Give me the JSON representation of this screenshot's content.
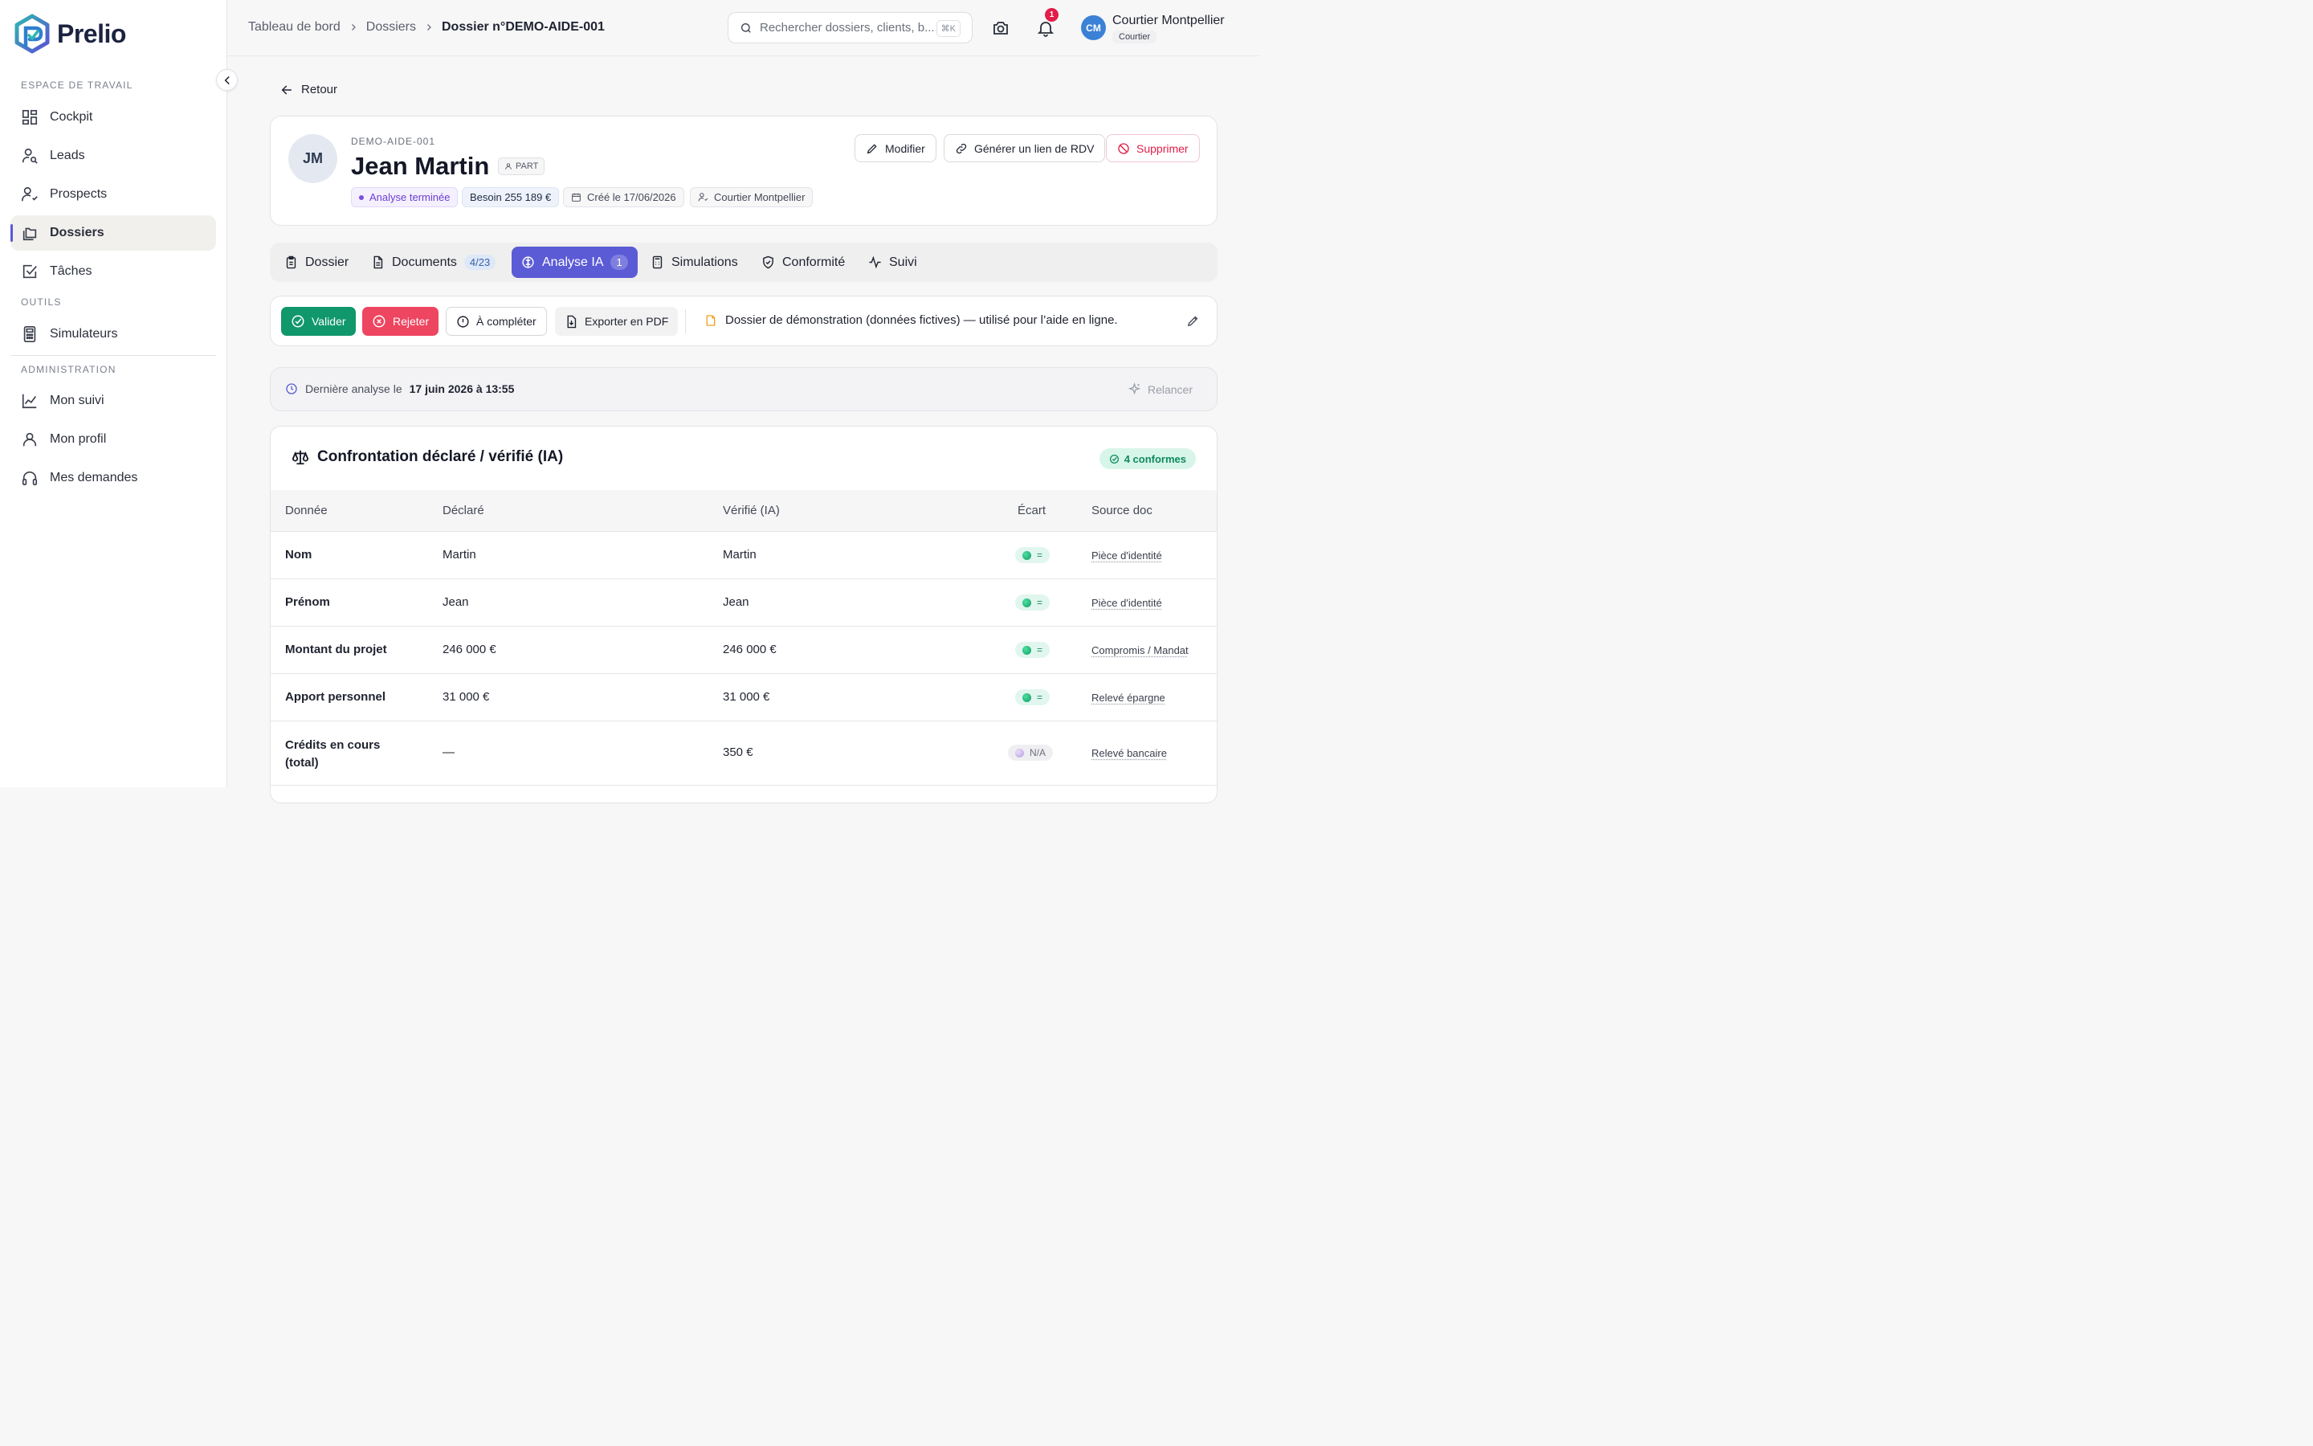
{
  "brand": {
    "name": "Prelio",
    "accent": "#5b5bd6"
  },
  "sidebar": {
    "workspace_label": "ESPACE DE TRAVAIL",
    "tools_label": "OUTILS",
    "admin_label": "ADMINISTRATION",
    "items": [
      {
        "label": "Cockpit",
        "icon": "grid-icon"
      },
      {
        "label": "Leads",
        "icon": "user-search-icon"
      },
      {
        "label": "Prospects",
        "icon": "user-check-icon"
      },
      {
        "label": "Dossiers",
        "icon": "folders-icon",
        "active": true
      },
      {
        "label": "Tâches",
        "icon": "checkbox-icon"
      },
      {
        "label": "Simulateurs",
        "icon": "calculator-icon"
      },
      {
        "label": "Mon suivi",
        "icon": "chart-line-icon"
      },
      {
        "label": "Mon profil",
        "icon": "user-icon"
      },
      {
        "label": "Mes demandes",
        "icon": "headset-icon"
      }
    ]
  },
  "topbar": {
    "breadcrumb": [
      "Tableau de bord",
      "Dossiers",
      "Dossier n°DEMO-AIDE-001"
    ],
    "search_placeholder": "Rechercher dossiers, clients, b...",
    "search_shortcut": "⌘K",
    "notifications_count": "1",
    "user": {
      "initials": "CM",
      "name": "Courtier Montpellier",
      "role": "Courtier"
    }
  },
  "back_label": "Retour",
  "dossier": {
    "initials": "JM",
    "reference": "DEMO-AIDE-001",
    "client_name": "Jean Martin",
    "type_tag": "PART",
    "status": "Analyse terminée",
    "besoin": "Besoin 255 189 €",
    "created": "Créé le 17/06/2026",
    "owner": "Courtier Montpellier",
    "actions": {
      "edit": "Modifier",
      "rdv": "Générer un lien de RDV",
      "delete": "Supprimer"
    }
  },
  "tabs": [
    {
      "label": "Dossier",
      "icon": "clipboard-icon"
    },
    {
      "label": "Documents",
      "icon": "document-icon",
      "count": "4/23"
    },
    {
      "label": "Analyse IA",
      "icon": "brain-icon",
      "count": "1",
      "active": true
    },
    {
      "label": "Simulations",
      "icon": "calculator-icon"
    },
    {
      "label": "Conformité",
      "icon": "shield-check-icon"
    },
    {
      "label": "Suivi",
      "icon": "activity-icon"
    }
  ],
  "toolbar": {
    "validate": "Valider",
    "reject": "Rejeter",
    "complete": "À compléter",
    "export": "Exporter en PDF",
    "note": "Dossier de démonstration (données fictives) — utilisé pour l’aide en ligne."
  },
  "analysis": {
    "prefix": "Dernière analyse le",
    "date": "17 juin 2026 à 13:55",
    "rerun": "Relancer"
  },
  "comparison": {
    "title": "Confrontation déclaré / vérifié (IA)",
    "badge": "4 conformes",
    "columns": [
      "Donnée",
      "Déclaré",
      "Vérifié (IA)",
      "Écart",
      "Source doc"
    ],
    "rows": [
      {
        "label": "Nom",
        "declared": "Martin",
        "verified": "Martin",
        "ecart": "=",
        "status": "ok",
        "source": "Pièce d'identité"
      },
      {
        "label": "Prénom",
        "declared": "Jean",
        "verified": "Jean",
        "ecart": "=",
        "status": "ok",
        "source": "Pièce d'identité"
      },
      {
        "label": "Montant du projet",
        "declared": "246 000 €",
        "verified": "246 000 €",
        "ecart": "=",
        "status": "ok",
        "source": "Compromis / Mandat"
      },
      {
        "label": "Apport personnel",
        "declared": "31 000 €",
        "verified": "31 000 €",
        "ecart": "=",
        "status": "ok",
        "source": "Relevé épargne"
      },
      {
        "label_line1": "Crédits en cours",
        "label_line2": "(total)",
        "declared": "—",
        "verified": "350 €",
        "ecart": "N/A",
        "status": "na",
        "source": "Relevé bancaire"
      }
    ]
  }
}
